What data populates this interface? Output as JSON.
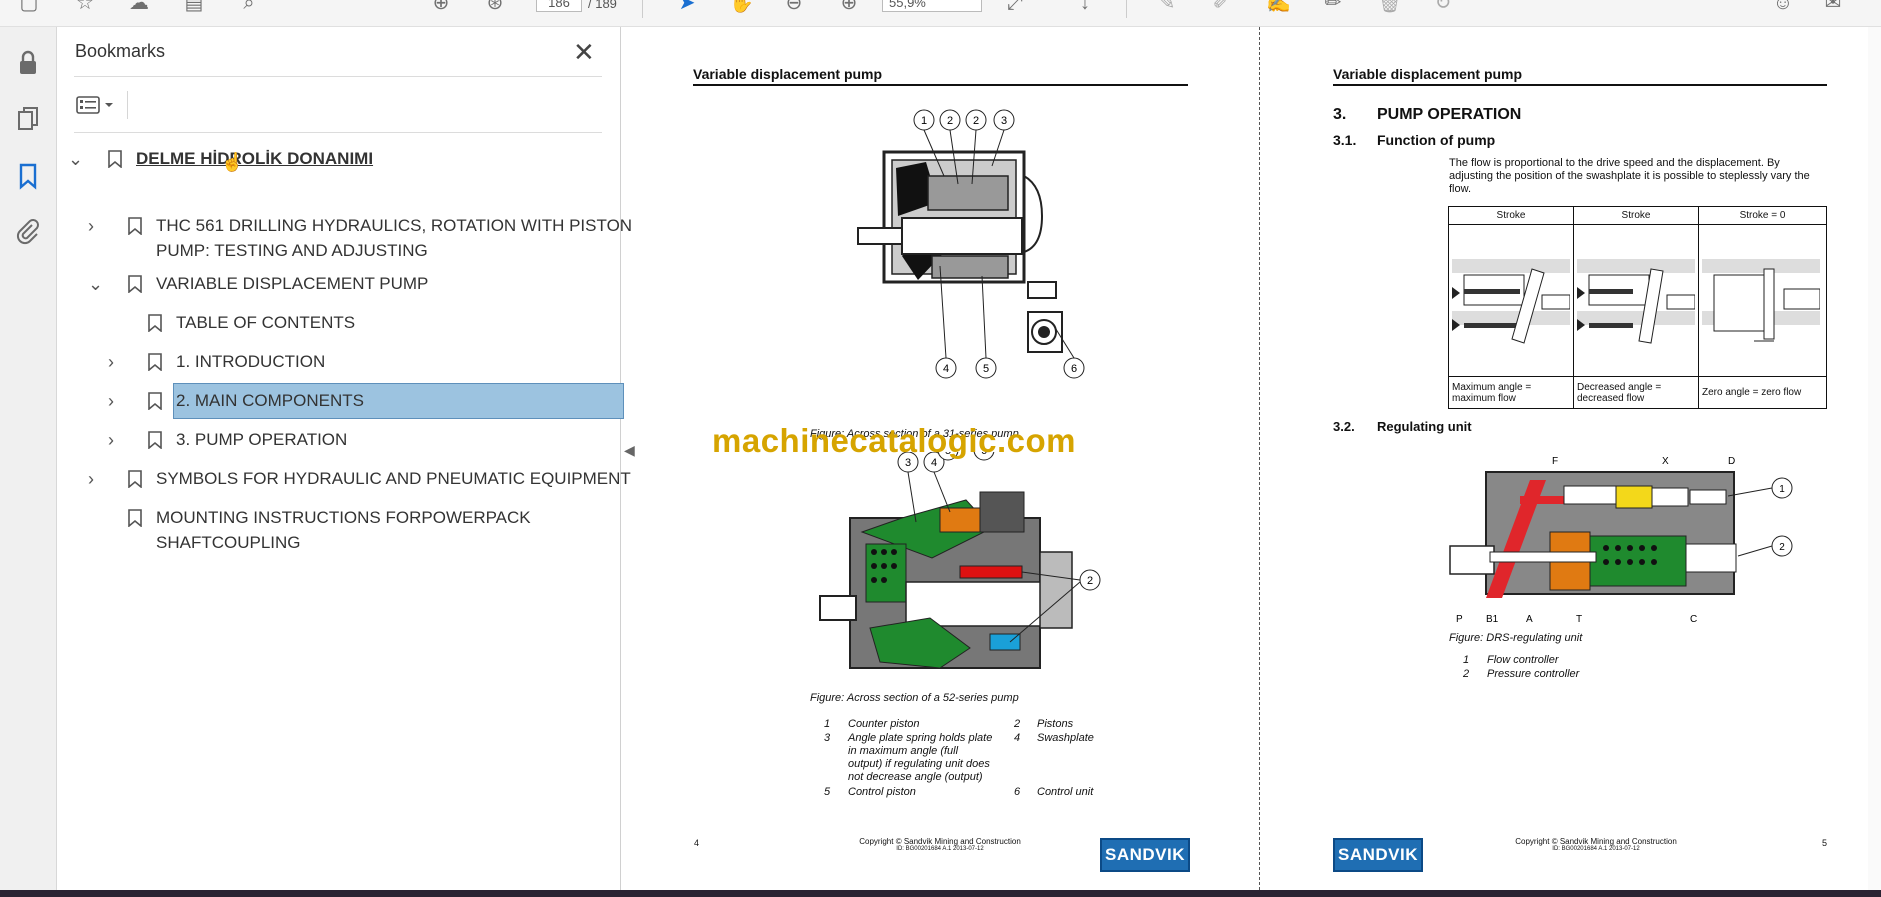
{
  "toolbar": {
    "page_current": "186",
    "page_total": "/ 189",
    "zoom": "55,9%"
  },
  "bookmarks_panel": {
    "title": "Bookmarks",
    "items": [
      {
        "label": "DELME HİDROLİK DONANIMI",
        "level": 0
      },
      {
        "label": "THC 561 DRILLING HYDRAULICS, ROTATION WITH PISTON",
        "label2": "PUMP: TESTING AND ADJUSTING",
        "level": 1
      },
      {
        "label": "VARIABLE DISPLACEMENT PUMP",
        "level": 1
      },
      {
        "label": "TABLE OF CONTENTS",
        "level": 2
      },
      {
        "label": "1. INTRODUCTION",
        "level": 2
      },
      {
        "label": "2. MAIN COMPONENTS",
        "level": 2,
        "selected": true
      },
      {
        "label": "3. PUMP OPERATION",
        "level": 2
      },
      {
        "label": "SYMBOLS FOR HYDRAULIC AND PNEUMATIC EQUIPMENT",
        "level": 1
      },
      {
        "label": "MOUNTING INSTRUCTIONS FORPOWERPACK",
        "label2": "SHAFTCOUPLING",
        "level": 1
      }
    ]
  },
  "left_page": {
    "header": "Variable displacement pump",
    "fig1_caption": "Figure: Across section of a 31-series pump",
    "fig2_caption": "Figure: Across section of a 52-series pump",
    "fig1_callouts": [
      "1",
      "2",
      "2",
      "3",
      "4",
      "5",
      "6"
    ],
    "fig2_callouts": [
      "3",
      "4",
      "5",
      "6",
      "2"
    ],
    "legend": [
      {
        "n": "1",
        "t": "Counter piston",
        "n2": "2",
        "t2": "Pistons"
      },
      {
        "n": "3",
        "t": "Angle plate spring holds plate",
        "n2": "4",
        "t2": "Swashplate"
      },
      {
        "n": "",
        "t": "in maximum angle (full",
        "n2": "",
        "t2": ""
      },
      {
        "n": "",
        "t": "output) if regulating unit does",
        "n2": "",
        "t2": ""
      },
      {
        "n": "",
        "t": "not decrease angle (output)",
        "n2": "",
        "t2": ""
      },
      {
        "n": "5",
        "t": "Control piston",
        "n2": "6",
        "t2": "Control unit"
      }
    ],
    "page_number": "4",
    "copyright": "Copyright © Sandvik Mining and Construction",
    "doc_id": "ID: BG00201684 A.1 2013-07-12",
    "logo": "SANDVIK"
  },
  "watermark": "machinecatalogic.com",
  "right_page": {
    "header": "Variable displacement pump",
    "section_num": "3.",
    "section_title": "PUMP OPERATION",
    "sub1_num": "3.1.",
    "sub1_title": "Function of pump",
    "body": "The flow is proportional to the drive speed and the displacement. By adjusting the position of the swashplate it is possible to steplessly vary the flow.",
    "table_headers": [
      "Stroke",
      "Stroke",
      "Stroke = 0"
    ],
    "table_captions": [
      "Maximum angle = maximum flow",
      "Decreased angle = decreased flow",
      "Zero angle = zero flow"
    ],
    "sub2_num": "3.2.",
    "sub2_title": "Regulating unit",
    "reg_labels": [
      "F",
      "X",
      "D",
      "P",
      "B1",
      "A",
      "T",
      "C",
      "1",
      "2"
    ],
    "fig_caption": "Figure: DRS-regulating unit",
    "legend": [
      {
        "n": "1",
        "t": "Flow controller"
      },
      {
        "n": "2",
        "t": "Pressure controller"
      }
    ],
    "page_number": "5",
    "copyright": "Copyright © Sandvik Mining and Construction",
    "doc_id": "ID: BG00201684 A.1 2013-07-12",
    "logo": "SANDVIK"
  }
}
